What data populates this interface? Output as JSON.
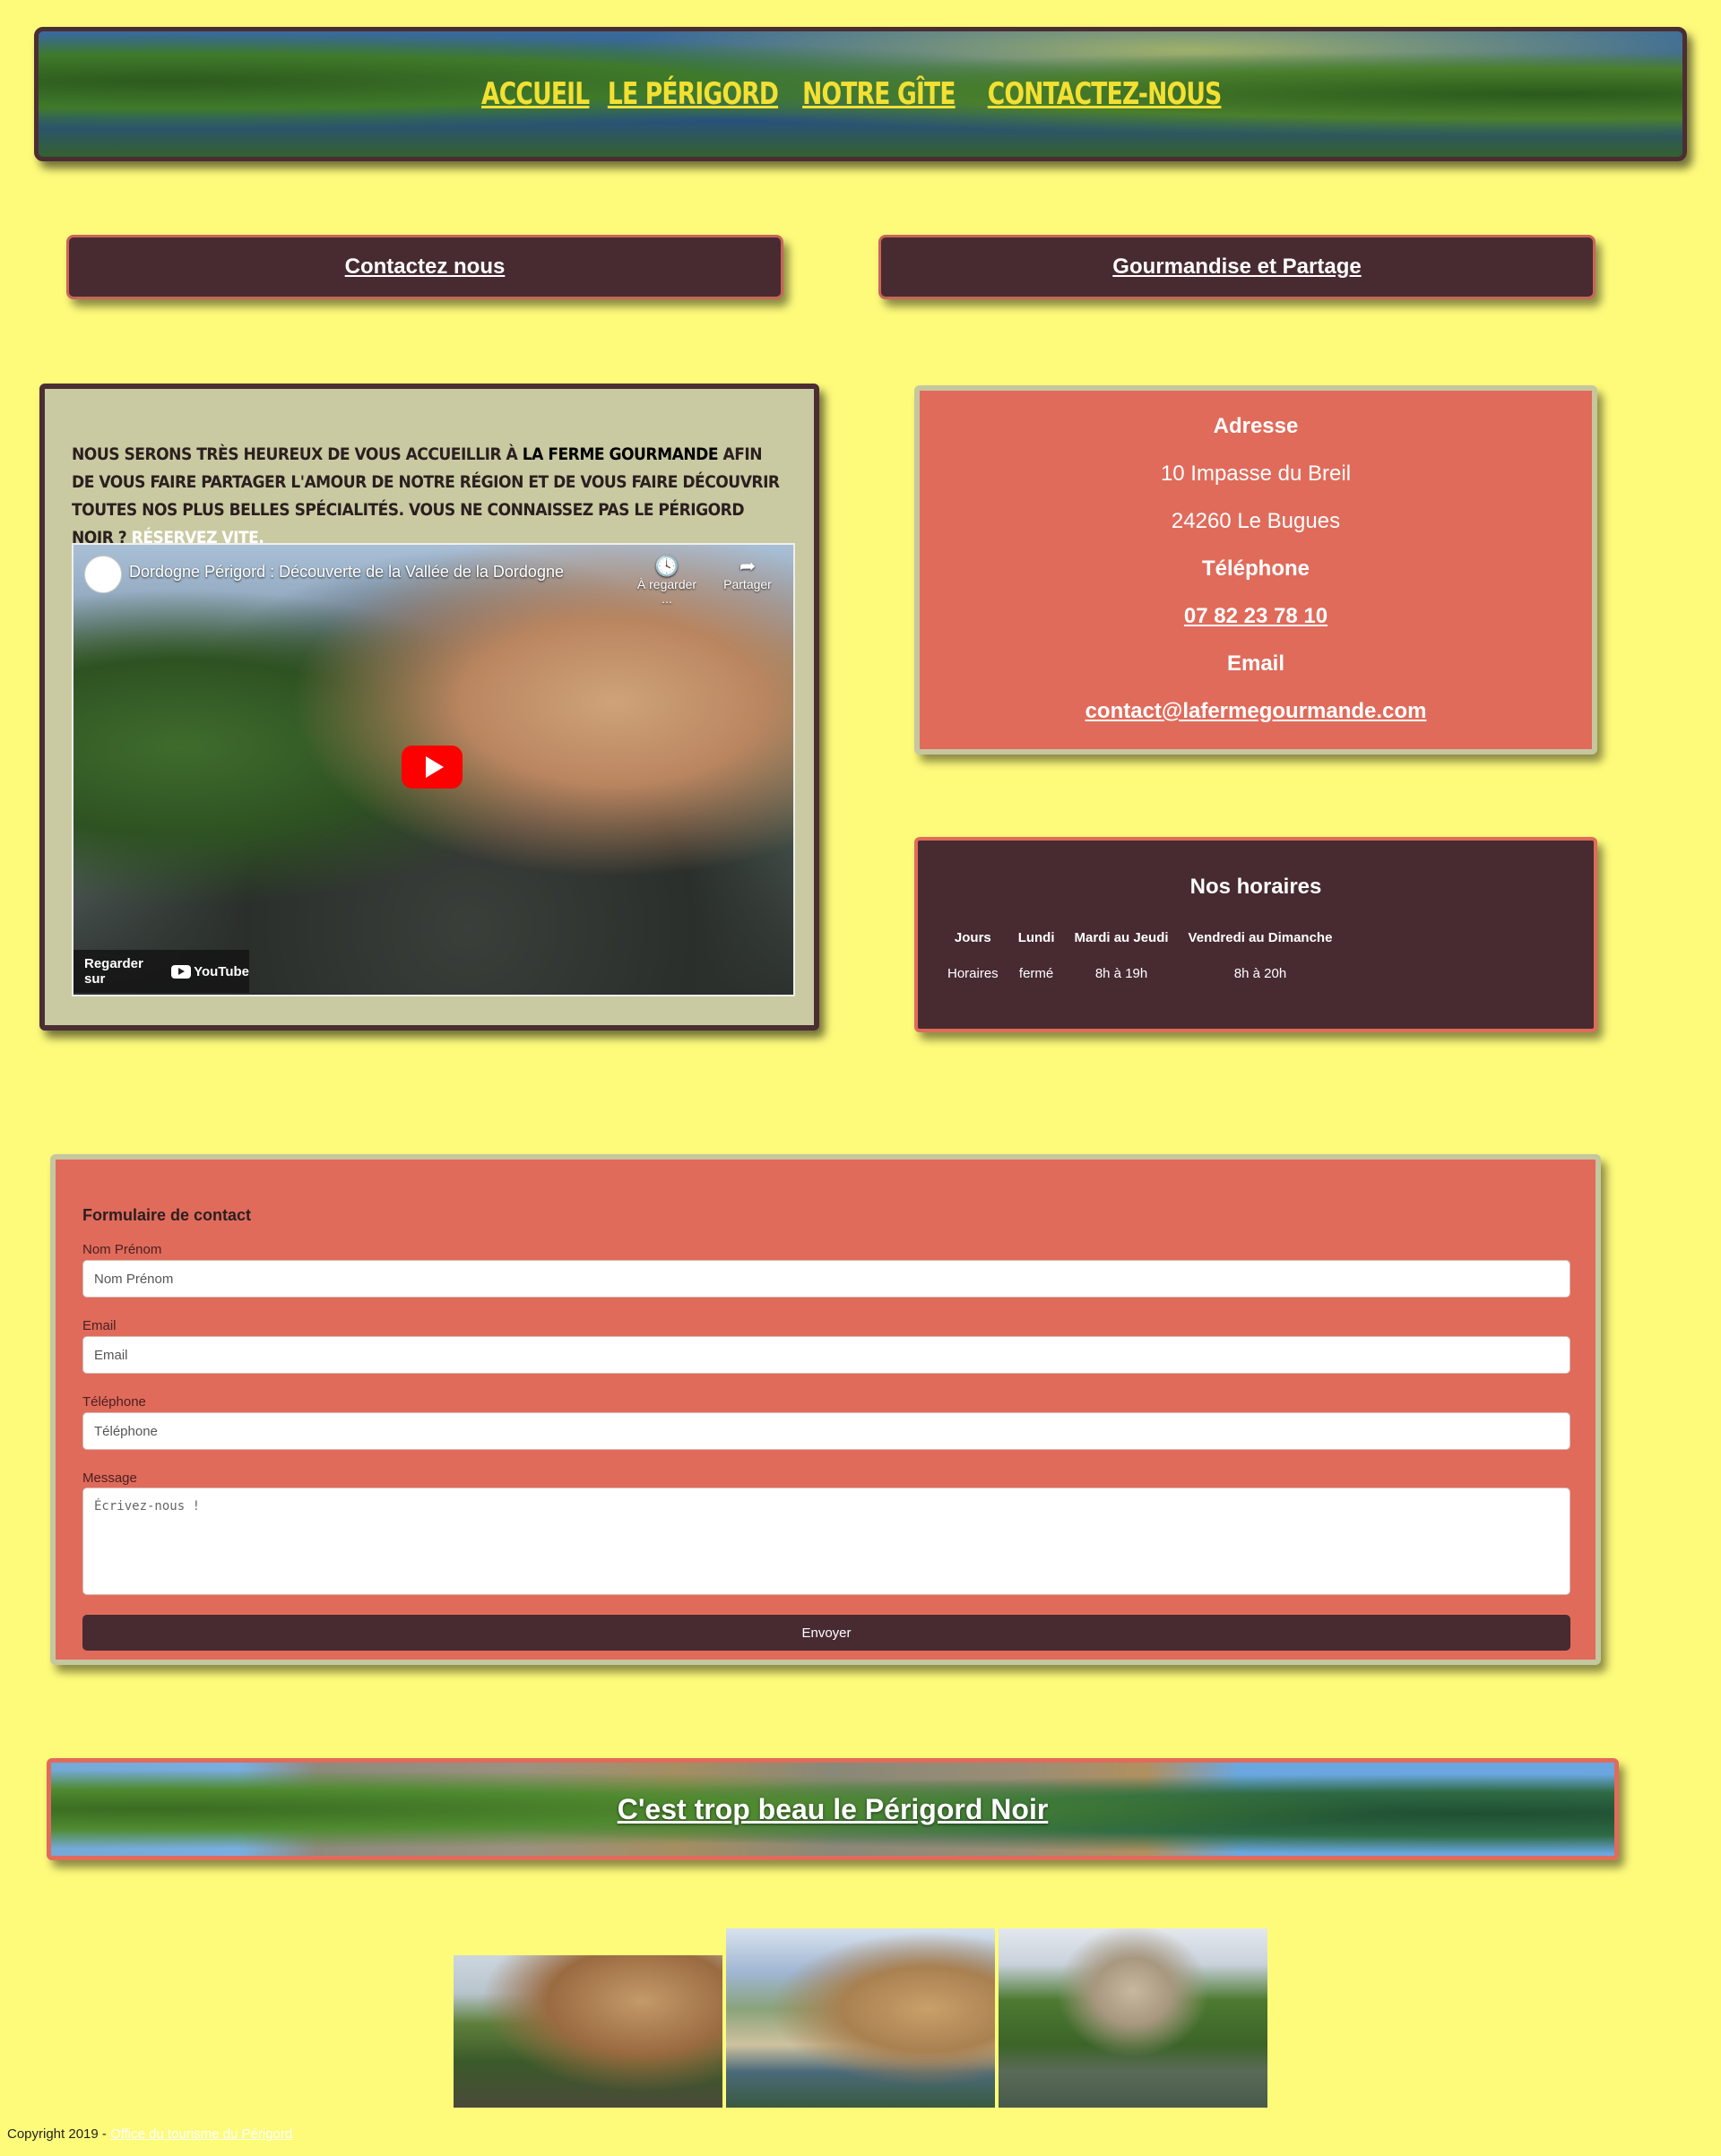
{
  "header": {
    "nav": [
      "Accueil",
      "Le Périgord",
      "Notre gîte",
      "Contactez-nous"
    ]
  },
  "buttons": {
    "contact": "Contactez nous",
    "gourmandise": "Gourmandise et Partage"
  },
  "welcome": {
    "text_1": "Nous serons très heureux de vous accueillir à ",
    "brand": "La Ferme Gourmande",
    "text_2": " afin de vous faire partager l'amour de notre région et de vous faire découvrir toutes nos plus belles spécialités. Vous ne connaissez pas le Périgord Noir ? ",
    "link": "Réservez vite."
  },
  "video": {
    "title": "Dordogne Périgord : Découverte de la Vallée de la Dordogne",
    "watch_later": "À regarder ...",
    "share": "Partager",
    "watch_on": "Regarder sur",
    "youtube": "YouTube"
  },
  "address": {
    "label": "Adresse",
    "street": "10 Impasse du Breil",
    "city": "24260 Le Bugues",
    "phone_label": "Téléphone",
    "phone": "07 82 23 78 10",
    "email_label": "Email",
    "email": "contact@lafermegourmande.com"
  },
  "hours": {
    "title": "Nos horaires",
    "headers": [
      "Jours",
      "Lundi",
      "Mardi au Jeudi",
      "Vendredi au Dimanche"
    ],
    "row": [
      "Horaires",
      "fermé",
      "8h à 19h",
      "8h à 20h"
    ]
  },
  "form": {
    "legend": "Formulaire de contact",
    "name_label": "Nom Prénom",
    "name_placeholder": "Nom Prénom",
    "email_label": "Email",
    "email_placeholder": "Email",
    "phone_label": "Téléphone",
    "phone_placeholder": "Téléphone",
    "message_label": "Message",
    "message_placeholder": "Écrivez-nous !",
    "submit": "Envoyer"
  },
  "banner": {
    "text": "C'est trop beau le Périgord Noir"
  },
  "footer": {
    "copyright": "Copyright 2019 - ",
    "link": "Office du tourisme du Périgord"
  }
}
